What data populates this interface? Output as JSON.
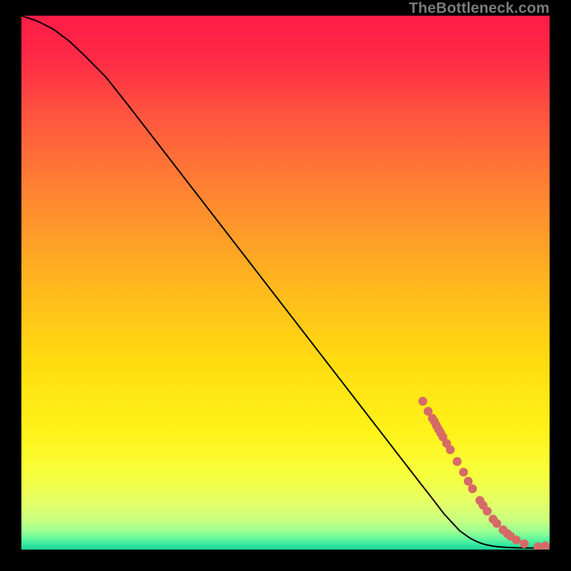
{
  "watermark": "TheBottleneck.com",
  "chart_data": {
    "type": "line",
    "title": "",
    "xlabel": "",
    "ylabel": "",
    "xlim": [
      0,
      100
    ],
    "ylim": [
      0,
      100
    ],
    "curve": {
      "name": "bottleneck-curve",
      "x": [
        0,
        3,
        6,
        9,
        12,
        16,
        20,
        25,
        30,
        35,
        40,
        45,
        50,
        55,
        60,
        65,
        70,
        75,
        78,
        80,
        83,
        85,
        86,
        87,
        88,
        89,
        90,
        92,
        94,
        96,
        98,
        100
      ],
      "y": [
        100,
        99,
        97.5,
        95.3,
        92.5,
        88.5,
        83.5,
        77.1,
        70.7,
        64.3,
        57.9,
        51.5,
        45.1,
        38.7,
        32.3,
        25.9,
        19.5,
        13.1,
        9.3,
        6.7,
        3.5,
        2.1,
        1.6,
        1.2,
        0.9,
        0.7,
        0.55,
        0.4,
        0.33,
        0.3,
        0.3,
        0.35
      ]
    },
    "scatter": {
      "name": "points",
      "color": "#d66a67",
      "x": [
        76.0,
        77.0,
        77.8,
        78.2,
        78.6,
        79.0,
        79.4,
        79.8,
        80.5,
        81.2,
        82.5,
        83.7,
        84.6,
        85.4,
        86.8,
        87.4,
        88.2,
        89.3,
        90.0,
        91.2,
        92.0,
        92.6,
        93.7,
        95.2,
        97.8,
        99.2
      ],
      "y": [
        27.8,
        25.9,
        24.6,
        24.0,
        23.2,
        22.5,
        21.8,
        21.1,
        19.9,
        18.7,
        16.5,
        14.5,
        12.8,
        11.4,
        9.2,
        8.3,
        7.2,
        5.7,
        4.9,
        3.7,
        3.0,
        2.5,
        1.8,
        1.1,
        0.55,
        0.7
      ]
    }
  }
}
